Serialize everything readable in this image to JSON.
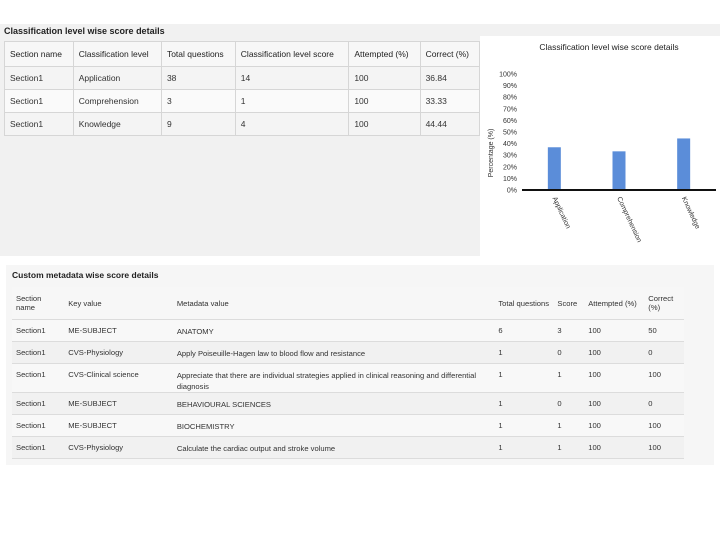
{
  "classification_section": {
    "title": "Classification level wise score details",
    "headers": [
      "Section name",
      "Classification level",
      "Total questions",
      "Classification level score",
      "Attempted (%)",
      "Correct (%)"
    ],
    "rows": [
      [
        "Section1",
        "Application",
        "38",
        "14",
        "100",
        "36.84"
      ],
      [
        "Section1",
        "Comprehension",
        "3",
        "1",
        "100",
        "33.33"
      ],
      [
        "Section1",
        "Knowledge",
        "9",
        "4",
        "100",
        "44.44"
      ]
    ]
  },
  "chart_data": {
    "type": "bar",
    "title": "Classification level wise score details",
    "ylabel": "Percentage (%)",
    "xlabel": "",
    "categories": [
      "Application",
      "Comprehension",
      "Knowledge"
    ],
    "values": [
      36.84,
      33.33,
      44.44
    ],
    "ylim": [
      0,
      100
    ],
    "yticks": [
      "0%",
      "10%",
      "20%",
      "30%",
      "40%",
      "50%",
      "60%",
      "70%",
      "80%",
      "90%",
      "100%"
    ],
    "bar_color": "#5b8dd9",
    "grid": false,
    "legend": "none"
  },
  "metadata_section": {
    "title": "Custom metadata wise score details",
    "headers": [
      "Section name",
      "Key value",
      "Metadata value",
      "Total questions",
      "Score",
      "Attempted (%)",
      "Correct (%)"
    ],
    "rows": [
      [
        "Section1",
        "ME-SUBJECT",
        "ANATOMY",
        "6",
        "3",
        "100",
        "50"
      ],
      [
        "Section1",
        "CVS-Physiology",
        "Apply Poiseuille-Hagen law to blood flow and resistance",
        "1",
        "0",
        "100",
        "0"
      ],
      [
        "Section1",
        "CVS-Clinical science",
        "Appreciate that there are individual strategies applied in clinical reasoning and differential diagnosis",
        "1",
        "1",
        "100",
        "100"
      ],
      [
        "Section1",
        "ME-SUBJECT",
        "BEHAVIOURAL SCIENCES",
        "1",
        "0",
        "100",
        "0"
      ],
      [
        "Section1",
        "ME-SUBJECT",
        "BIOCHEMISTRY",
        "1",
        "1",
        "100",
        "100"
      ],
      [
        "Section1",
        "CVS-Physiology",
        "Calculate the cardiac output and stroke volume",
        "1",
        "1",
        "100",
        "100"
      ]
    ]
  }
}
